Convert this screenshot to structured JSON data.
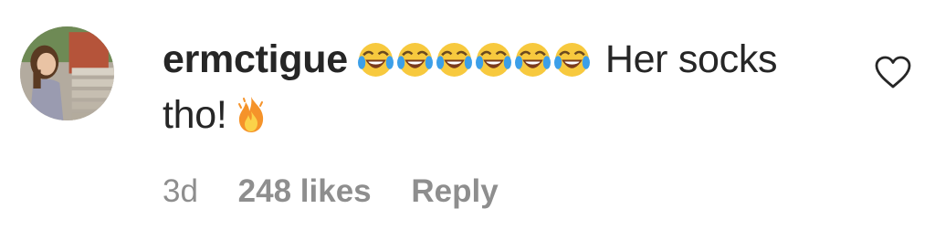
{
  "comment": {
    "username": "ermctigue",
    "text_after_emojis": "Her socks",
    "text_line2": "tho!",
    "emojis": [
      "face-with-tears-of-joy",
      "face-with-tears-of-joy",
      "face-with-tears-of-joy",
      "face-with-tears-of-joy",
      "face-with-tears-of-joy",
      "face-with-tears-of-joy",
      "fire"
    ],
    "timestamp": "3d",
    "likes": "248 likes",
    "reply_label": "Reply",
    "like_icon": "heart-outline-icon"
  }
}
